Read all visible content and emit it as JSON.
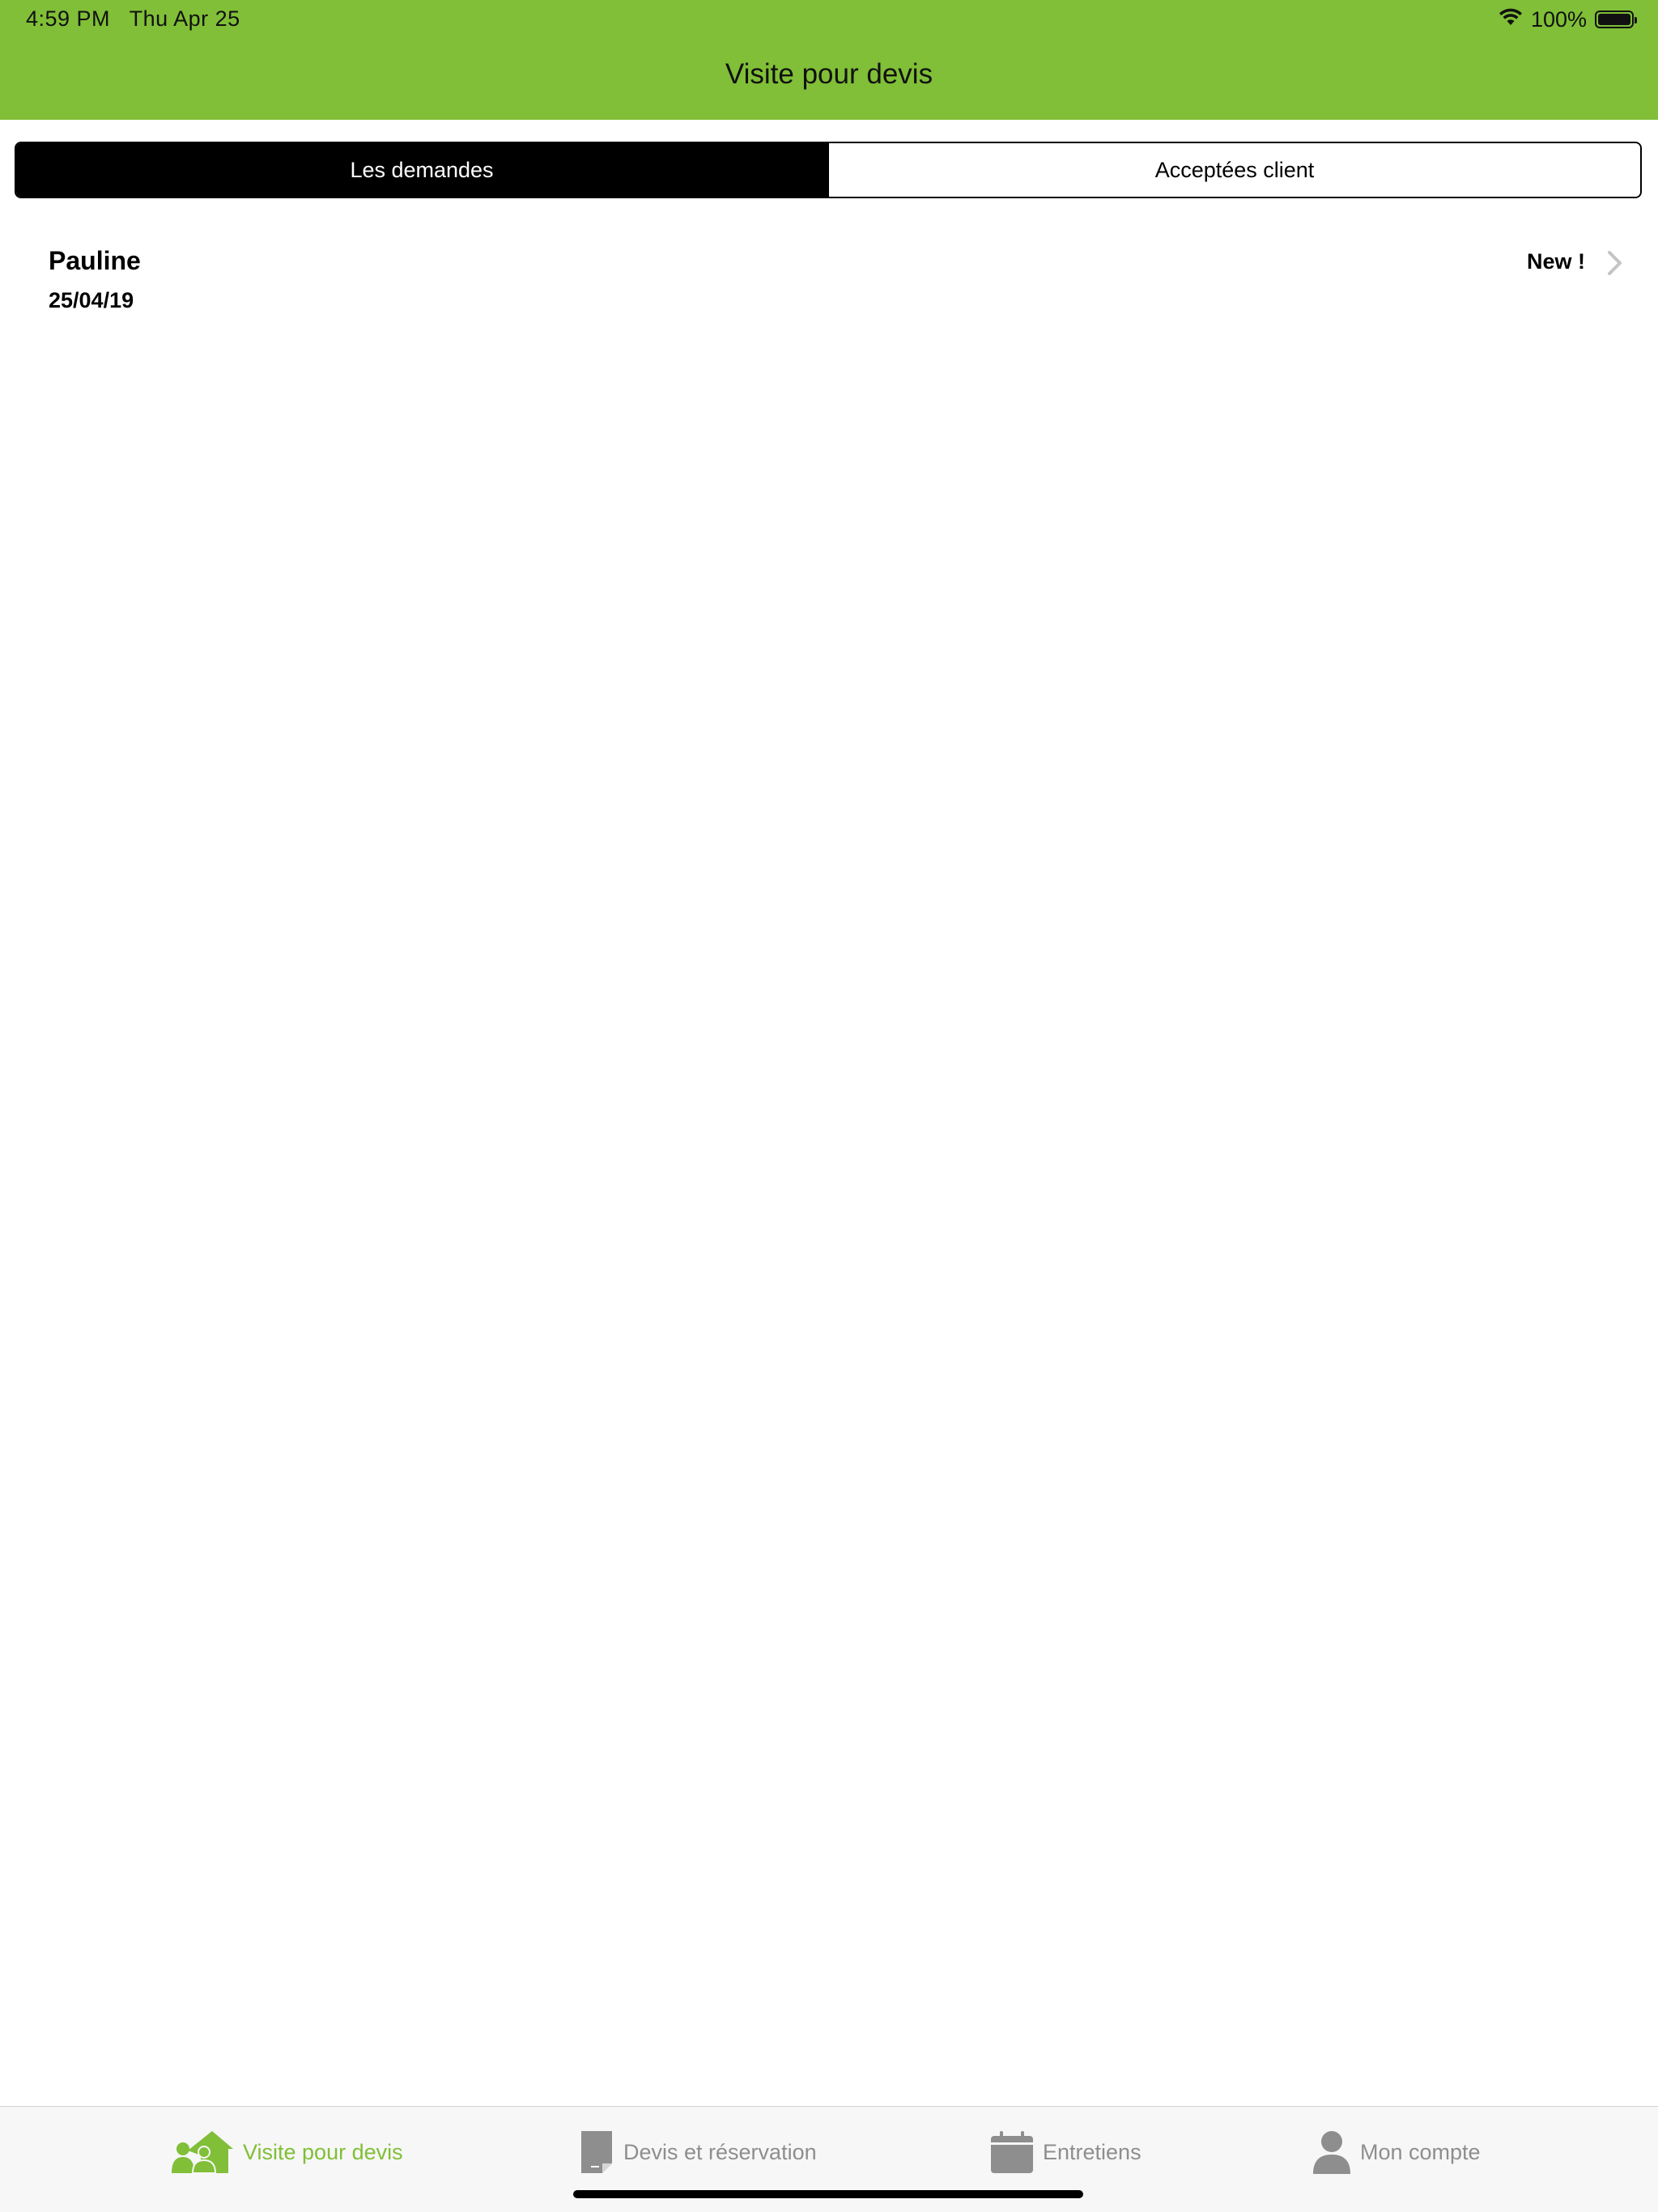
{
  "status_bar": {
    "time": "4:59 PM",
    "date": "Thu Apr 25",
    "battery": "100%",
    "battery_level": 1.0,
    "icons": [
      "wifi-icon",
      "battery-icon"
    ]
  },
  "nav": {
    "title": "Visite pour devis"
  },
  "segments": [
    {
      "label": "Les demandes",
      "selected": true
    },
    {
      "label": "Acceptées client",
      "selected": false
    }
  ],
  "list": [
    {
      "name": "Pauline",
      "date": "25/04/19",
      "badge": "New !"
    }
  ],
  "tabbar": [
    {
      "label": "Visite pour devis",
      "icon": "house-people-icon",
      "active": true
    },
    {
      "label": "Devis et réservation",
      "icon": "document-icon",
      "active": false
    },
    {
      "label": "Entretiens",
      "icon": "calendar-icon",
      "active": false
    },
    {
      "label": "Mon compte",
      "icon": "person-icon",
      "active": false
    }
  ],
  "colors": {
    "accent": "#80bf37",
    "tab_inactive": "#8e8e8e",
    "segment_active_bg": "#000000"
  }
}
